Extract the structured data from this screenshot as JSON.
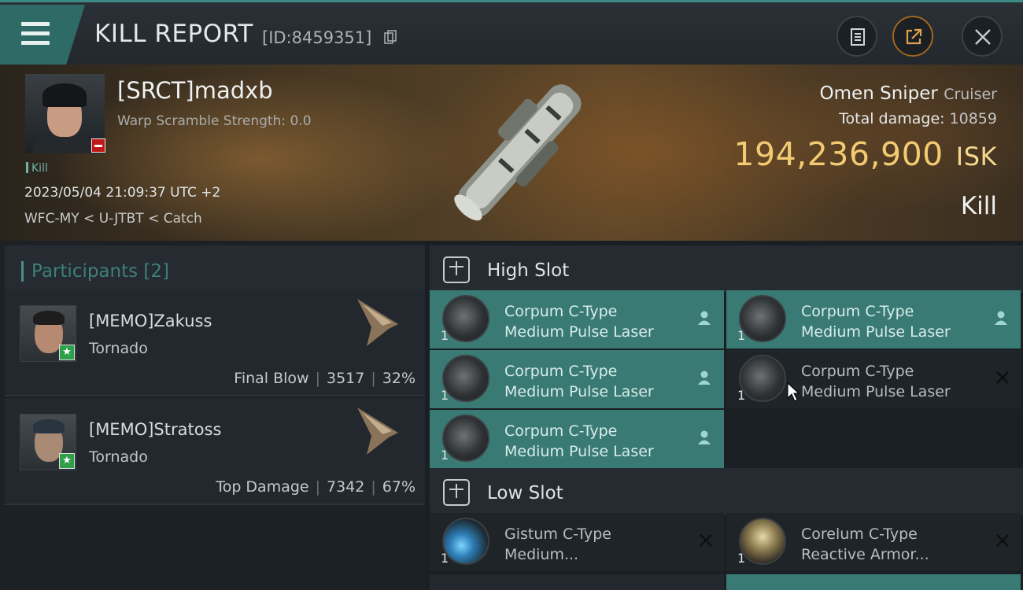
{
  "header": {
    "title": "KILL REPORT",
    "id_label": "[ID:8459351]"
  },
  "victim": {
    "name": "[SRCT]madxb",
    "warp_scramble": "Warp Scramble Strength: 0.0",
    "tag": "Kill",
    "timestamp": "2023/05/04 21:09:37 UTC +2",
    "location": "WFC-MY < U-JTBT < Catch",
    "ship_name": "Omen Sniper",
    "ship_class": "Cruiser",
    "total_damage_label": "Total damage:",
    "total_damage_value": "10859",
    "isk_value": "194,236,900",
    "isk_unit": "ISK",
    "result": "Kill"
  },
  "participants": {
    "header": "Participants [2]",
    "items": [
      {
        "name": "[MEMO]Zakuss",
        "ship": "Tornado",
        "role": "Final Blow",
        "damage": "3517",
        "percent": "32%"
      },
      {
        "name": "[MEMO]Stratoss",
        "ship": "Tornado",
        "role": "Top Damage",
        "damage": "7342",
        "percent": "67%"
      }
    ]
  },
  "slots": {
    "high": {
      "label": "High Slot",
      "modules": [
        {
          "line1": "Corpum C-Type",
          "line2": "Medium Pulse Laser",
          "qty": "1",
          "state": "fitted"
        },
        {
          "line1": "Corpum C-Type",
          "line2": "Medium Pulse Laser",
          "qty": "1",
          "state": "fitted"
        },
        {
          "line1": "Corpum C-Type",
          "line2": "Medium Pulse Laser",
          "qty": "1",
          "state": "fitted"
        },
        {
          "line1": "Corpum C-Type",
          "line2": "Medium Pulse Laser",
          "qty": "1",
          "state": "destroyed"
        },
        {
          "line1": "Corpum C-Type",
          "line2": "Medium Pulse Laser",
          "qty": "1",
          "state": "fitted"
        }
      ]
    },
    "low": {
      "label": "Low Slot",
      "modules": [
        {
          "line1": "Gistum C-Type",
          "line2": "Medium...",
          "qty": "1",
          "state": "destroyed"
        },
        {
          "line1": "Corelum C-Type",
          "line2": "Reactive Armor...",
          "qty": "1",
          "state": "destroyed"
        }
      ]
    }
  },
  "colors": {
    "accent": "#3a7a74",
    "isk": "#f2cb72",
    "badge_minus": "#c01818",
    "badge_star": "#2fa049"
  },
  "icons": [
    "menu-icon",
    "copy-icon",
    "clipboard-icon",
    "external-link-icon",
    "close-icon",
    "slot-icon",
    "person-icon",
    "x-icon",
    "star-icon",
    "minus-icon"
  ]
}
